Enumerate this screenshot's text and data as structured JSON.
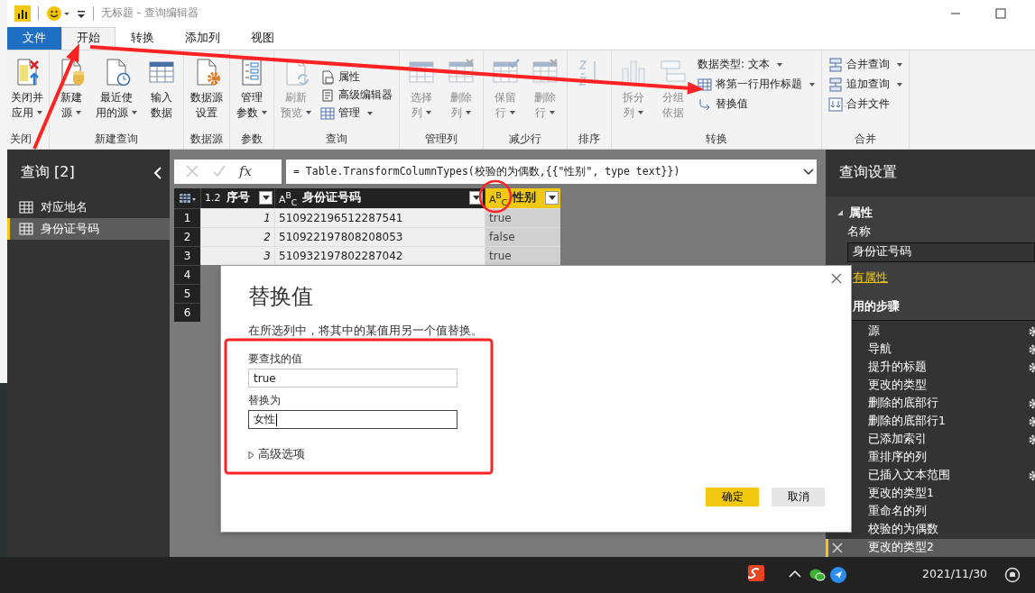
{
  "title_bar": {
    "title": "无标题 - 查询编辑器"
  },
  "menu_tabs": [
    {
      "label": "文件",
      "kind": "file",
      "selected": false
    },
    {
      "label": "开始",
      "kind": "tab",
      "selected": true
    },
    {
      "label": "转换",
      "kind": "tab",
      "selected": false
    },
    {
      "label": "添加列",
      "kind": "tab",
      "selected": false
    },
    {
      "label": "视图",
      "kind": "tab",
      "selected": false
    }
  ],
  "ribbon": {
    "groups": [
      {
        "label": "关闭",
        "large": [
          {
            "lines": [
              "关闭并",
              "应用"
            ],
            "dropdown": true,
            "disabled": false
          }
        ]
      },
      {
        "label": "新建查询",
        "large": [
          {
            "lines": [
              "新建",
              "源"
            ],
            "dropdown": true,
            "disabled": false
          },
          {
            "lines": [
              "最近使",
              "用的源"
            ],
            "dropdown": true,
            "disabled": false
          },
          {
            "lines": [
              "输入",
              "数据"
            ],
            "dropdown": false,
            "disabled": false
          }
        ]
      },
      {
        "label": "数据源",
        "large": [
          {
            "lines": [
              "数据源",
              "设置"
            ],
            "dropdown": false,
            "disabled": false
          }
        ]
      },
      {
        "label": "参数",
        "large": [
          {
            "lines": [
              "管理",
              "参数"
            ],
            "dropdown": true,
            "disabled": false
          }
        ]
      },
      {
        "label": "查询",
        "large": [
          {
            "lines": [
              "刷新",
              "预览"
            ],
            "dropdown": true,
            "disabled": true
          }
        ],
        "small": [
          {
            "label": "属性",
            "dropdown": false
          },
          {
            "label": "高级编辑器",
            "dropdown": false
          },
          {
            "label": "管理",
            "dropdown": true
          }
        ]
      },
      {
        "label": "管理列",
        "large": [
          {
            "lines": [
              "选择",
              "列"
            ],
            "dropdown": true,
            "disabled": true
          },
          {
            "lines": [
              "删除",
              "列"
            ],
            "dropdown": true,
            "disabled": true
          }
        ]
      },
      {
        "label": "减少行",
        "large": [
          {
            "lines": [
              "保留",
              "行"
            ],
            "dropdown": true,
            "disabled": true
          },
          {
            "lines": [
              "删除",
              "行"
            ],
            "dropdown": true,
            "disabled": true
          }
        ]
      },
      {
        "label": "排序",
        "large": [
          {
            "disabled": true
          }
        ]
      },
      {
        "label": "转换",
        "large": [
          {
            "lines": [
              "拆分",
              "列"
            ],
            "dropdown": true,
            "disabled": true
          },
          {
            "lines": [
              "分组",
              "依据"
            ],
            "dropdown": false,
            "disabled": true
          }
        ],
        "small": [
          {
            "label": "数据类型: 文本",
            "dropdown": true
          },
          {
            "label": "将第一行用作标题",
            "dropdown": true
          },
          {
            "label": "替换值",
            "dropdown": false
          }
        ]
      },
      {
        "label": "合并",
        "small": [
          {
            "label": "合并查询",
            "dropdown": true
          },
          {
            "label": "追加查询",
            "dropdown": true
          },
          {
            "label": "合并文件",
            "dropdown": false
          }
        ]
      }
    ]
  },
  "queries_panel": {
    "title": "查询 [2]",
    "items": [
      {
        "label": "对应地名",
        "selected": false
      },
      {
        "label": "身份证号码",
        "selected": true
      }
    ]
  },
  "formula_bar": {
    "fx": "fx",
    "formula": "= Table.TransformColumnTypes(校验的为偶数,{{\"性别\", type text}})"
  },
  "table": {
    "columns": [
      {
        "type": "1.2",
        "label": "序号",
        "selected": false
      },
      {
        "type": "A$^{B}$$_{C}$",
        "label": "身份证号码",
        "selected": false
      },
      {
        "type": "A$^{B}$$_{C}$",
        "label": "性别",
        "selected": true
      }
    ],
    "rows": [
      {
        "number": "1",
        "cells": [
          "1",
          "510922196512287541",
          "true"
        ]
      },
      {
        "number": "2",
        "cells": [
          "2",
          "510922197808208053",
          "false"
        ]
      },
      {
        "number": "3",
        "cells": [
          "3",
          "510932197802287042",
          "true"
        ]
      },
      {
        "number": "4"
      },
      {
        "number": "5"
      },
      {
        "number": "6"
      }
    ]
  },
  "dialog": {
    "title": "替换值",
    "description": "在所选列中，将其中的某值用另一个值替换。",
    "find_label": "要查找的值",
    "find_value": "true",
    "replace_label": "替换为",
    "replace_value": "女性",
    "advanced": {
      "label": "高级选项",
      "expanded": false
    },
    "ok": "确定",
    "cancel": "取消"
  },
  "query_settings": {
    "title": "查询设置",
    "properties": {
      "heading": "属性",
      "expanded": true,
      "name_label": "名称",
      "name_value": "身份证号码",
      "all_properties_link": "有属性"
    },
    "steps_heading": "用的步骤",
    "steps": [
      {
        "label": "源",
        "settings": true,
        "selected": false
      },
      {
        "label": "导航",
        "settings": true,
        "selected": false
      },
      {
        "label": "提升的标题",
        "settings": true,
        "selected": false
      },
      {
        "label": "更改的类型",
        "settings": false,
        "selected": false
      },
      {
        "label": "删除的底部行",
        "settings": true,
        "selected": false
      },
      {
        "label": "删除的底部行1",
        "settings": true,
        "selected": false
      },
      {
        "label": "已添加索引",
        "settings": true,
        "selected": false
      },
      {
        "label": "重排序的列",
        "settings": false,
        "selected": false
      },
      {
        "label": "已插入文本范围",
        "settings": true,
        "selected": false
      },
      {
        "label": "更改的类型1",
        "settings": false,
        "selected": false
      },
      {
        "label": "重命名的列",
        "settings": false,
        "selected": false
      },
      {
        "label": "校验的为偶数",
        "settings": false,
        "selected": false
      },
      {
        "label": "更改的类型2",
        "settings": false,
        "selected": true
      }
    ]
  },
  "taskbar": {
    "clock": "2021/11/30"
  }
}
